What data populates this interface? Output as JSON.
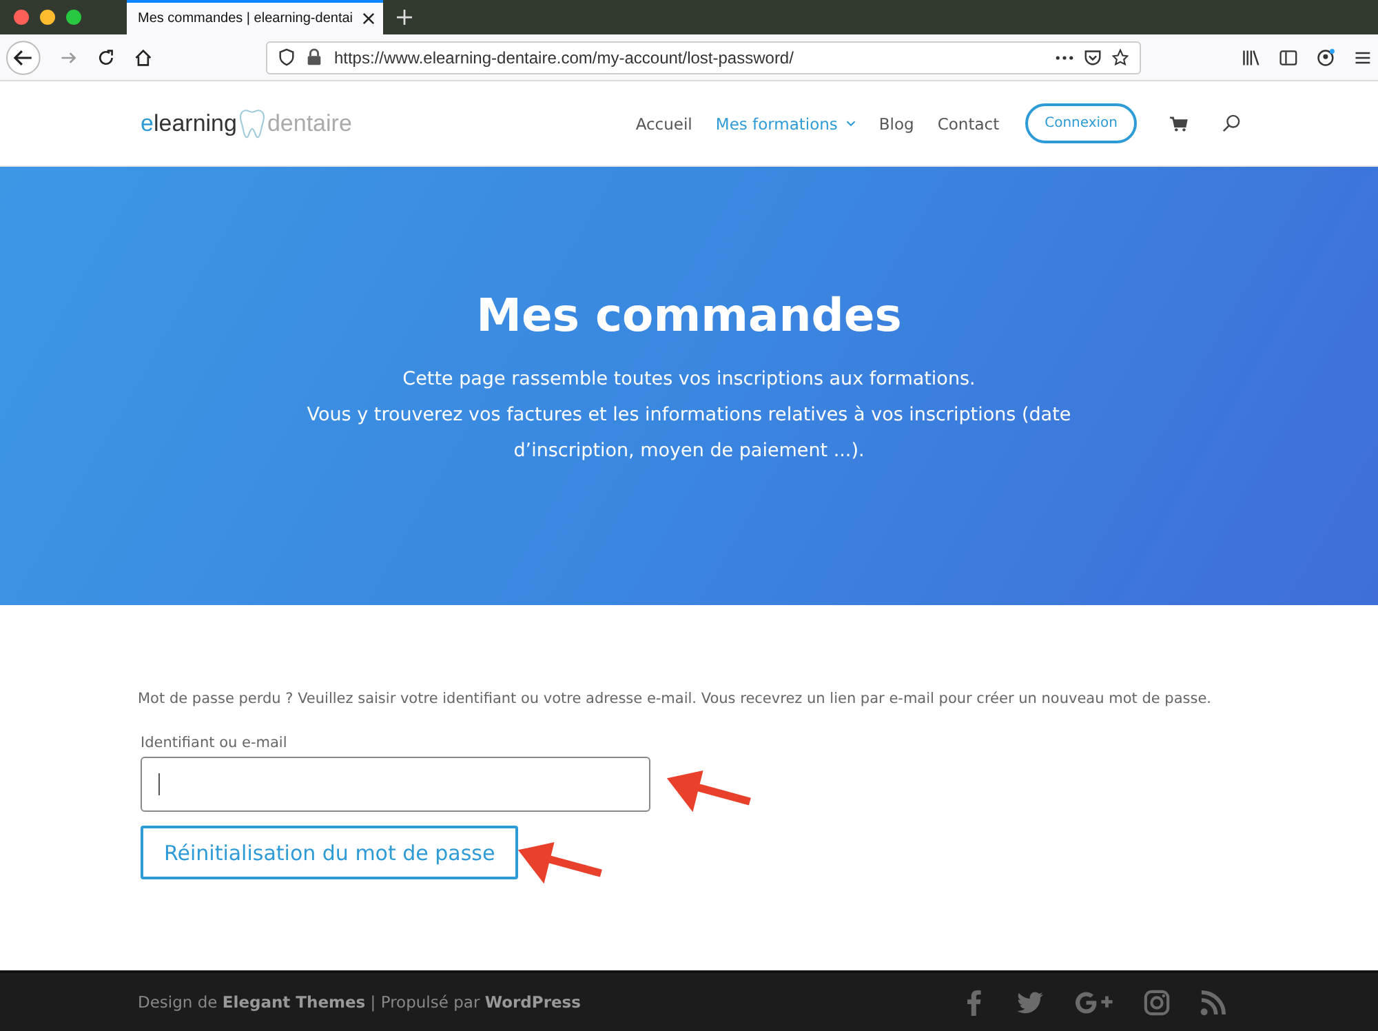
{
  "browser": {
    "tab_title": "Mes commandes | elearning-dentai",
    "url": "https://www.elearning-dentaire.com/my-account/lost-password/"
  },
  "header": {
    "logo_left": "elearning",
    "logo_right": "dentaire",
    "nav": [
      {
        "label": "Accueil",
        "selected": false,
        "dropdown": false
      },
      {
        "label": "Mes formations",
        "selected": true,
        "dropdown": true
      },
      {
        "label": "Blog",
        "selected": false,
        "dropdown": false
      },
      {
        "label": "Contact",
        "selected": false,
        "dropdown": false
      }
    ],
    "login_button": "Connexion"
  },
  "hero": {
    "title": "Mes commandes",
    "lines": [
      "Cette page rassemble toutes vos inscriptions aux formations.",
      "Vous y trouverez vos factures et les informations relatives à vos inscriptions (date d’inscription, moyen de paiement ...)."
    ]
  },
  "form": {
    "intro": "Mot de passe perdu ? Veuillez saisir votre identifiant ou votre adresse e-mail. Vous recevrez un lien par e-mail pour créer un nouveau mot de passe.",
    "field_label": "Identifiant ou e-mail",
    "submit": "Réinitialisation du mot de passe"
  },
  "footer": {
    "credits": "Design de **Elegant Themes** | Propulsé par **WordPress**"
  }
}
